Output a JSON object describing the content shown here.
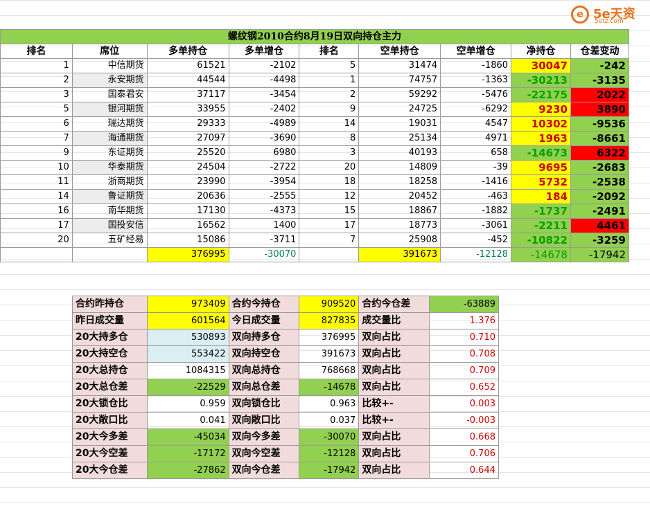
{
  "logo": {
    "mark": "e",
    "text": "5e天资",
    "sub": "5etz.com"
  },
  "title": "螺纹钢2010合约8月19日双向持仓主力",
  "headers": [
    "排名",
    "席位",
    "多单持仓",
    "多单增仓",
    "排名",
    "空单持仓",
    "空单增仓",
    "净持仓",
    "仓差变动"
  ],
  "rows": [
    {
      "rank": "1",
      "seat": "中信期货",
      "long": "61521",
      "long_chg": "-2102",
      "srank": "5",
      "short": "31474",
      "short_chg": "-1860",
      "net": "30047",
      "diff": "-242"
    },
    {
      "rank": "2",
      "seat": "永安期货",
      "long": "44544",
      "long_chg": "-4498",
      "srank": "1",
      "short": "74757",
      "short_chg": "-1363",
      "net": "-30213",
      "diff": "-3135"
    },
    {
      "rank": "3",
      "seat": "国泰君安",
      "long": "37117",
      "long_chg": "-3454",
      "srank": "2",
      "short": "59292",
      "short_chg": "-5476",
      "net": "-22175",
      "diff": "2022"
    },
    {
      "rank": "5",
      "seat": "银河期货",
      "long": "33955",
      "long_chg": "-2402",
      "srank": "9",
      "short": "24725",
      "short_chg": "-6292",
      "net": "9230",
      "diff": "3890"
    },
    {
      "rank": "6",
      "seat": "瑞达期货",
      "long": "29333",
      "long_chg": "-4989",
      "srank": "14",
      "short": "19031",
      "short_chg": "4547",
      "net": "10302",
      "diff": "-9536"
    },
    {
      "rank": "7",
      "seat": "海通期货",
      "long": "27097",
      "long_chg": "-3690",
      "srank": "8",
      "short": "25134",
      "short_chg": "4971",
      "net": "1963",
      "diff": "-8661"
    },
    {
      "rank": "9",
      "seat": "东证期货",
      "long": "25520",
      "long_chg": "6980",
      "srank": "3",
      "short": "40193",
      "short_chg": "658",
      "net": "-14673",
      "diff": "6322"
    },
    {
      "rank": "10",
      "seat": "华泰期货",
      "long": "24504",
      "long_chg": "-2722",
      "srank": "20",
      "short": "14809",
      "short_chg": "-39",
      "net": "9695",
      "diff": "-2683"
    },
    {
      "rank": "11",
      "seat": "浙商期货",
      "long": "23990",
      "long_chg": "-3954",
      "srank": "18",
      "short": "18258",
      "short_chg": "-1416",
      "net": "5732",
      "diff": "-2538"
    },
    {
      "rank": "14",
      "seat": "鲁证期货",
      "long": "20636",
      "long_chg": "-2555",
      "srank": "12",
      "short": "20452",
      "short_chg": "-463",
      "net": "184",
      "diff": "-2092"
    },
    {
      "rank": "16",
      "seat": "南华期货",
      "long": "17130",
      "long_chg": "-4373",
      "srank": "15",
      "short": "18867",
      "short_chg": "-1882",
      "net": "-1737",
      "diff": "-2491"
    },
    {
      "rank": "17",
      "seat": "国投安信",
      "long": "16562",
      "long_chg": "1400",
      "srank": "17",
      "short": "18773",
      "short_chg": "-3061",
      "net": "-2211",
      "diff": "4461"
    },
    {
      "rank": "20",
      "seat": "五矿经易",
      "long": "15086",
      "long_chg": "-3711",
      "srank": "7",
      "short": "25908",
      "short_chg": "-452",
      "net": "-10822",
      "diff": "-3259"
    }
  ],
  "totals": {
    "long": "376995",
    "long_chg": "-30070",
    "short": "391673",
    "short_chg": "-12128",
    "net": "-14678",
    "diff": "-17942"
  },
  "summary": [
    {
      "l1": "合约昨持仓",
      "v1": "973409",
      "l2": "合约今持仓",
      "v2": "909520",
      "l3": "合约今仓差",
      "v3": "-63889"
    },
    {
      "l1": "昨日成交量",
      "v1": "601564",
      "l2": "今日成交量",
      "v2": "827835",
      "l3": "成交量比",
      "v3": "1.376"
    },
    {
      "l1": "20大持多仓",
      "v1": "530893",
      "l2": "双向持多仓",
      "v2": "376995",
      "l3": "双向占比",
      "v3": "0.710"
    },
    {
      "l1": "20大持空仓",
      "v1": "553422",
      "l2": "双向持空仓",
      "v2": "391673",
      "l3": "双向占比",
      "v3": "0.708"
    },
    {
      "l1": "20大总持仓",
      "v1": "1084315",
      "l2": "双向总持仓",
      "v2": "768668",
      "l3": "双向占比",
      "v3": "0.709"
    },
    {
      "l1": "20大总仓差",
      "v1": "-22529",
      "l2": "双向总仓差",
      "v2": "-14678",
      "l3": "双向占比",
      "v3": "0.652"
    },
    {
      "l1": "20大锁仓比",
      "v1": "0.959",
      "l2": "双向锁仓比",
      "v2": "0.963",
      "l3": "比较+-",
      "v3": "0.003"
    },
    {
      "l1": "20大敞口比",
      "v1": "0.041",
      "l2": "双向敞口比",
      "v2": "0.037",
      "l3": "比较+-",
      "v3": "-0.003"
    },
    {
      "l1": "20大今多差",
      "v1": "-45034",
      "l2": "双向今多差",
      "v2": "-30070",
      "l3": "双向占比",
      "v3": "0.668"
    },
    {
      "l1": "20大今空差",
      "v1": "-17172",
      "l2": "双向今空差",
      "v2": "-12128",
      "l3": "双向占比",
      "v3": "0.706"
    },
    {
      "l1": "20大今仓差",
      "v1": "-27862",
      "l2": "双向今仓差",
      "v2": "-17942",
      "l3": "双向占比",
      "v3": "0.644"
    }
  ],
  "colors": {
    "yellow": "#ffff00",
    "green": "#92d050",
    "red": "#ff0000",
    "pink": "#f2dcdb",
    "lightblue": "#daeef3"
  }
}
